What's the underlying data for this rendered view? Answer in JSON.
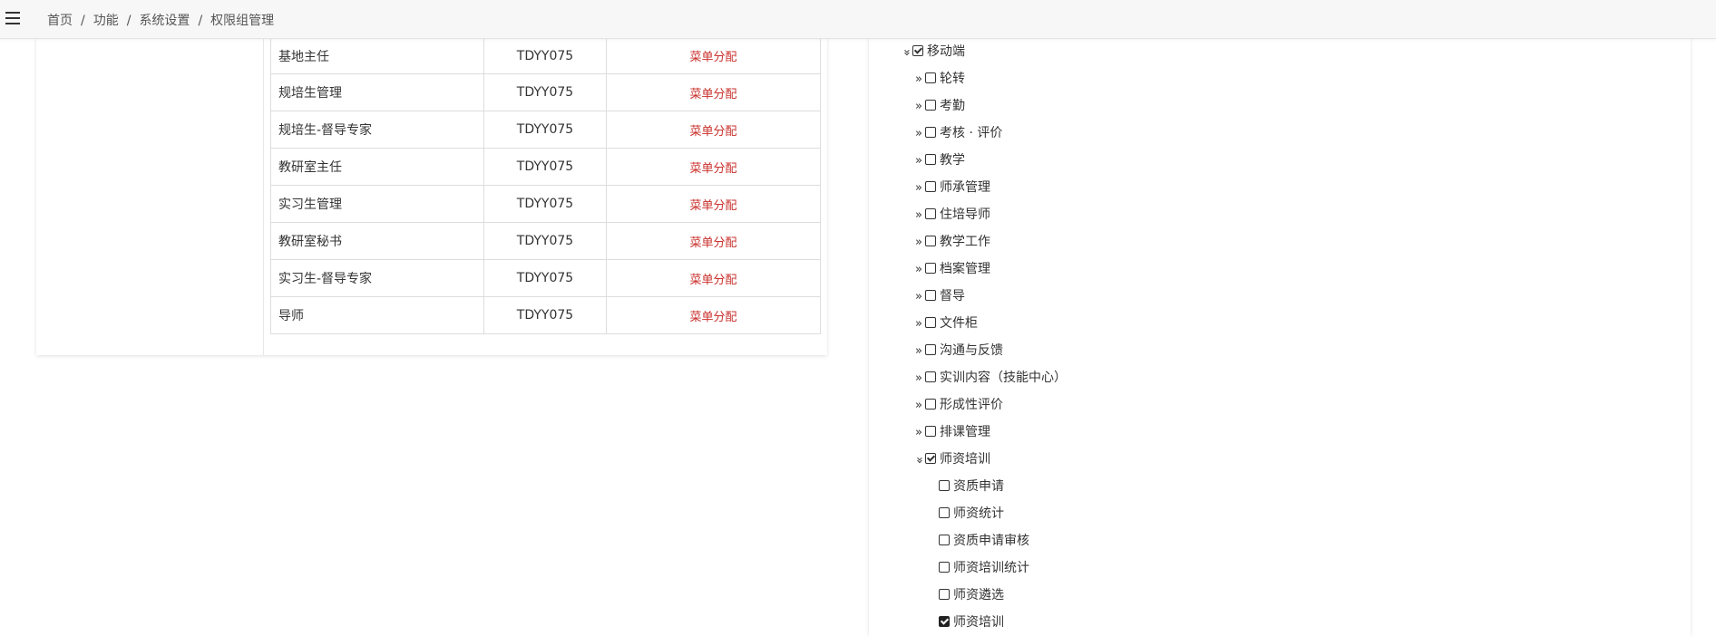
{
  "breadcrumb": {
    "items": [
      "首页",
      "功能",
      "系统设置",
      "权限组管理"
    ],
    "separator": "/"
  },
  "roles": [
    {
      "name": "基地主任",
      "code": "TDYY075",
      "action": "菜单分配"
    },
    {
      "name": "规培生管理",
      "code": "TDYY075",
      "action": "菜单分配"
    },
    {
      "name": "规培生-督导专家",
      "code": "TDYY075",
      "action": "菜单分配"
    },
    {
      "name": "教研室主任",
      "code": "TDYY075",
      "action": "菜单分配"
    },
    {
      "name": "实习生管理",
      "code": "TDYY075",
      "action": "菜单分配"
    },
    {
      "name": "教研室秘书",
      "code": "TDYY075",
      "action": "菜单分配"
    },
    {
      "name": "实习生-督导专家",
      "code": "TDYY075",
      "action": "菜单分配"
    },
    {
      "name": "导师",
      "code": "TDYY075",
      "action": "菜单分配"
    }
  ],
  "tree": {
    "root": {
      "label": "移动端",
      "checked": true,
      "expanded": true
    },
    "groups": [
      {
        "label": "轮转",
        "checked": false
      },
      {
        "label": "考勤",
        "checked": false
      },
      {
        "label": "考核 · 评价",
        "checked": false
      },
      {
        "label": "教学",
        "checked": false
      },
      {
        "label": "师承管理",
        "checked": false
      },
      {
        "label": "住培导师",
        "checked": false
      },
      {
        "label": "教学工作",
        "checked": false
      },
      {
        "label": "档案管理",
        "checked": false
      },
      {
        "label": "督导",
        "checked": false
      },
      {
        "label": "文件柜",
        "checked": false
      },
      {
        "label": "沟通与反馈",
        "checked": false
      },
      {
        "label": "实训内容（技能中心）",
        "checked": false
      },
      {
        "label": "形成性评价",
        "checked": false
      },
      {
        "label": "排课管理",
        "checked": false
      }
    ],
    "expanded_group": {
      "label": "师资培训",
      "checked": true
    },
    "children": [
      {
        "label": "资质申请",
        "checked": false
      },
      {
        "label": "师资统计",
        "checked": false
      },
      {
        "label": "资质申请审核",
        "checked": false
      },
      {
        "label": "师资培训统计",
        "checked": false
      },
      {
        "label": "师资遴选",
        "checked": false
      },
      {
        "label": "师资培训",
        "checked": true
      }
    ],
    "icons": {
      "collapsed": "double-chevron-right-icon",
      "expanded": "double-chevron-down-icon"
    }
  },
  "colors": {
    "action_link": "#c9302c"
  }
}
